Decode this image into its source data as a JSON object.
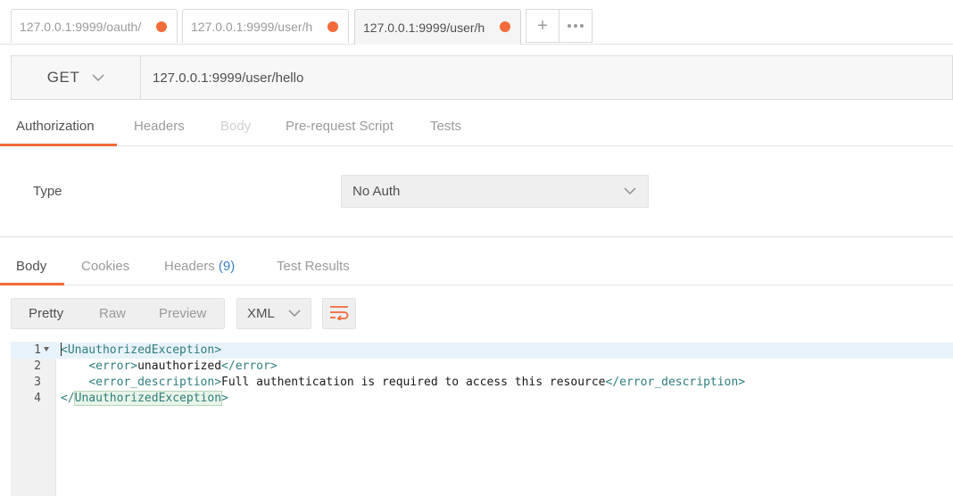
{
  "tabs": [
    {
      "label": "127.0.0.1:9999/oauth/",
      "active": false
    },
    {
      "label": "127.0.0.1:9999/user/h",
      "active": false
    },
    {
      "label": "127.0.0.1:9999/user/h",
      "active": true
    }
  ],
  "tab_actions": {
    "add_label": "+"
  },
  "request": {
    "method": "GET",
    "url": "127.0.0.1:9999/user/hello"
  },
  "request_tabs": {
    "authorization": "Authorization",
    "headers": "Headers",
    "body": "Body",
    "prerequest": "Pre-request Script",
    "tests": "Tests"
  },
  "auth": {
    "type_label": "Type",
    "type_value": "No Auth"
  },
  "response_tabs": {
    "body": "Body",
    "cookies": "Cookies",
    "headers": "Headers",
    "headers_count": "(9)",
    "test_results": "Test Results"
  },
  "response_view": {
    "pretty": "Pretty",
    "raw": "Raw",
    "preview": "Preview",
    "format": "XML"
  },
  "response_body": {
    "line_numbers": [
      "1",
      "2",
      "3",
      "4"
    ],
    "root_tag": "UnauthorizedException",
    "error_tag": "error",
    "error_value": "unauthorized",
    "desc_tag": "error_description",
    "desc_value": "Full authentication is required to access this resource"
  },
  "colors": {
    "accent": "#f26b3a",
    "xml_tag": "#2f7d7d",
    "count": "#3b7fc4"
  }
}
